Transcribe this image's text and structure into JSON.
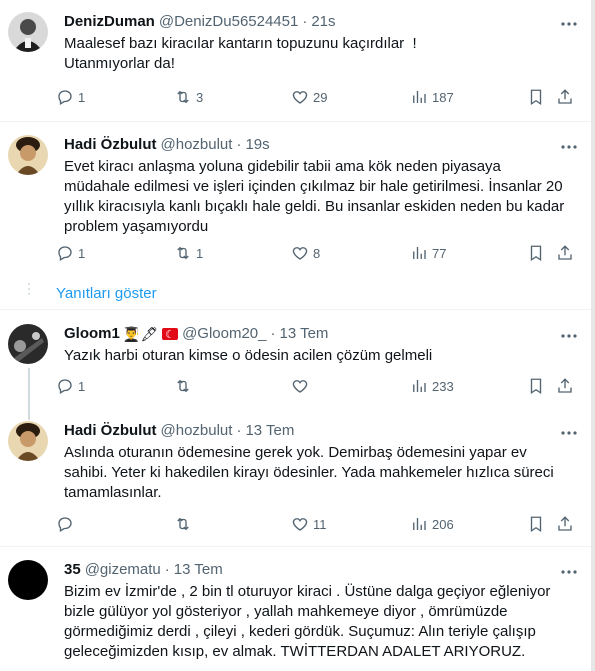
{
  "tweets": [
    {
      "name": "DenizDuman",
      "handle": "@DenizDu56524451",
      "time": "21s",
      "text": "Maalesef bazı kiracılar kantarın topuzunu kaçırdılar  !\nUtanmıyorlar da!",
      "replies": "1",
      "retweets": "3",
      "likes": "29",
      "views": "187"
    },
    {
      "name": "Hadi Özbulut",
      "handle": "@hozbulut",
      "time": "19s",
      "text": "Evet kiracı anlaşma yoluna gidebilir tabii ama kök neden piyasaya müdahale edilmesi ve işleri içinden çıkılmaz bir hale getirilmesi. İnsanlar 20 yıllık kiracısıyla kanlı bıçaklı hale geldi. Bu insanlar eskiden neden bu kadar problem yaşamıyordu",
      "replies": "1",
      "retweets": "1",
      "likes": "8",
      "views": "77"
    },
    {
      "name": "Gloom1",
      "name_emojis": "👨‍🎓🖋",
      "handle": "@Gloom20_",
      "time": "13 Tem",
      "text": "Yazık harbi oturan kimse o ödesin acilen çözüm gelmeli",
      "replies": "1",
      "retweets": "",
      "likes": "",
      "views": "233"
    },
    {
      "name": "Hadi Özbulut",
      "handle": "@hozbulut",
      "time": "13 Tem",
      "text": "Aslında oturanın ödemesine gerek yok. Demirbaş ödemesini yapar ev sahibi. Yeter ki hakedilen kirayı ödesinler. Yada mahkemeler hızlıca süreci tamamlasınlar.",
      "replies": "",
      "retweets": "",
      "likes": "11",
      "views": "206"
    },
    {
      "name": "35",
      "handle": "@gizematu",
      "time": "13 Tem",
      "text": "Bizim ev İzmir'de , 2 bin tl oturuyor kiraci . Üstüne dalga geçiyor eğleniyor bizle gülüyor yol gösteriyor , yallah mahkemeye diyor , ömrümüzde görmediğimiz derdi , çileyi , kederi gördük. Suçumuz: Alın teriyle çalışıp geleceğimizden kısıp, ev almak. TWİTTERDAN ADALET ARIYORUZ."
    }
  ],
  "show_replies_label": "Yanıtları göster",
  "dot": "·",
  "icons": [
    "more-icon",
    "reply-icon",
    "retweet-icon",
    "like-icon",
    "views-icon",
    "bookmark-icon",
    "share-icon"
  ]
}
